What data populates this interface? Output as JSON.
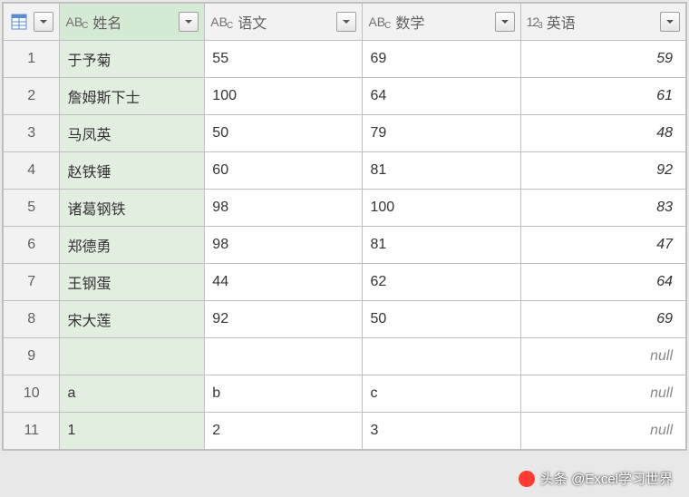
{
  "columns": {
    "rownum": "",
    "name": "姓名",
    "chinese": "语文",
    "math": "数学",
    "english": "英语"
  },
  "nullText": "null",
  "rows": [
    {
      "n": "1",
      "name": "于予菊",
      "chinese": "55",
      "math": "69",
      "english": "59"
    },
    {
      "n": "2",
      "name": "詹姆斯下士",
      "chinese": "100",
      "math": "64",
      "english": "61"
    },
    {
      "n": "3",
      "name": "马凤英",
      "chinese": "50",
      "math": "79",
      "english": "48"
    },
    {
      "n": "4",
      "name": "赵铁锤",
      "chinese": "60",
      "math": "81",
      "english": "92"
    },
    {
      "n": "5",
      "name": "诸葛钢铁",
      "chinese": "98",
      "math": "100",
      "english": "83"
    },
    {
      "n": "6",
      "name": "郑德勇",
      "chinese": "98",
      "math": "81",
      "english": "47"
    },
    {
      "n": "7",
      "name": "王钢蛋",
      "chinese": "44",
      "math": "62",
      "english": "64"
    },
    {
      "n": "8",
      "name": "宋大莲",
      "chinese": "92",
      "math": "50",
      "english": "69"
    },
    {
      "n": "9",
      "name": "",
      "chinese": "",
      "math": "",
      "english": null
    },
    {
      "n": "10",
      "name": "a",
      "chinese": "b",
      "math": "c",
      "english": null
    },
    {
      "n": "11",
      "name": "1",
      "chinese": "2",
      "math": "3",
      "english": null
    }
  ],
  "watermark": "头条 @Excel学习世界"
}
